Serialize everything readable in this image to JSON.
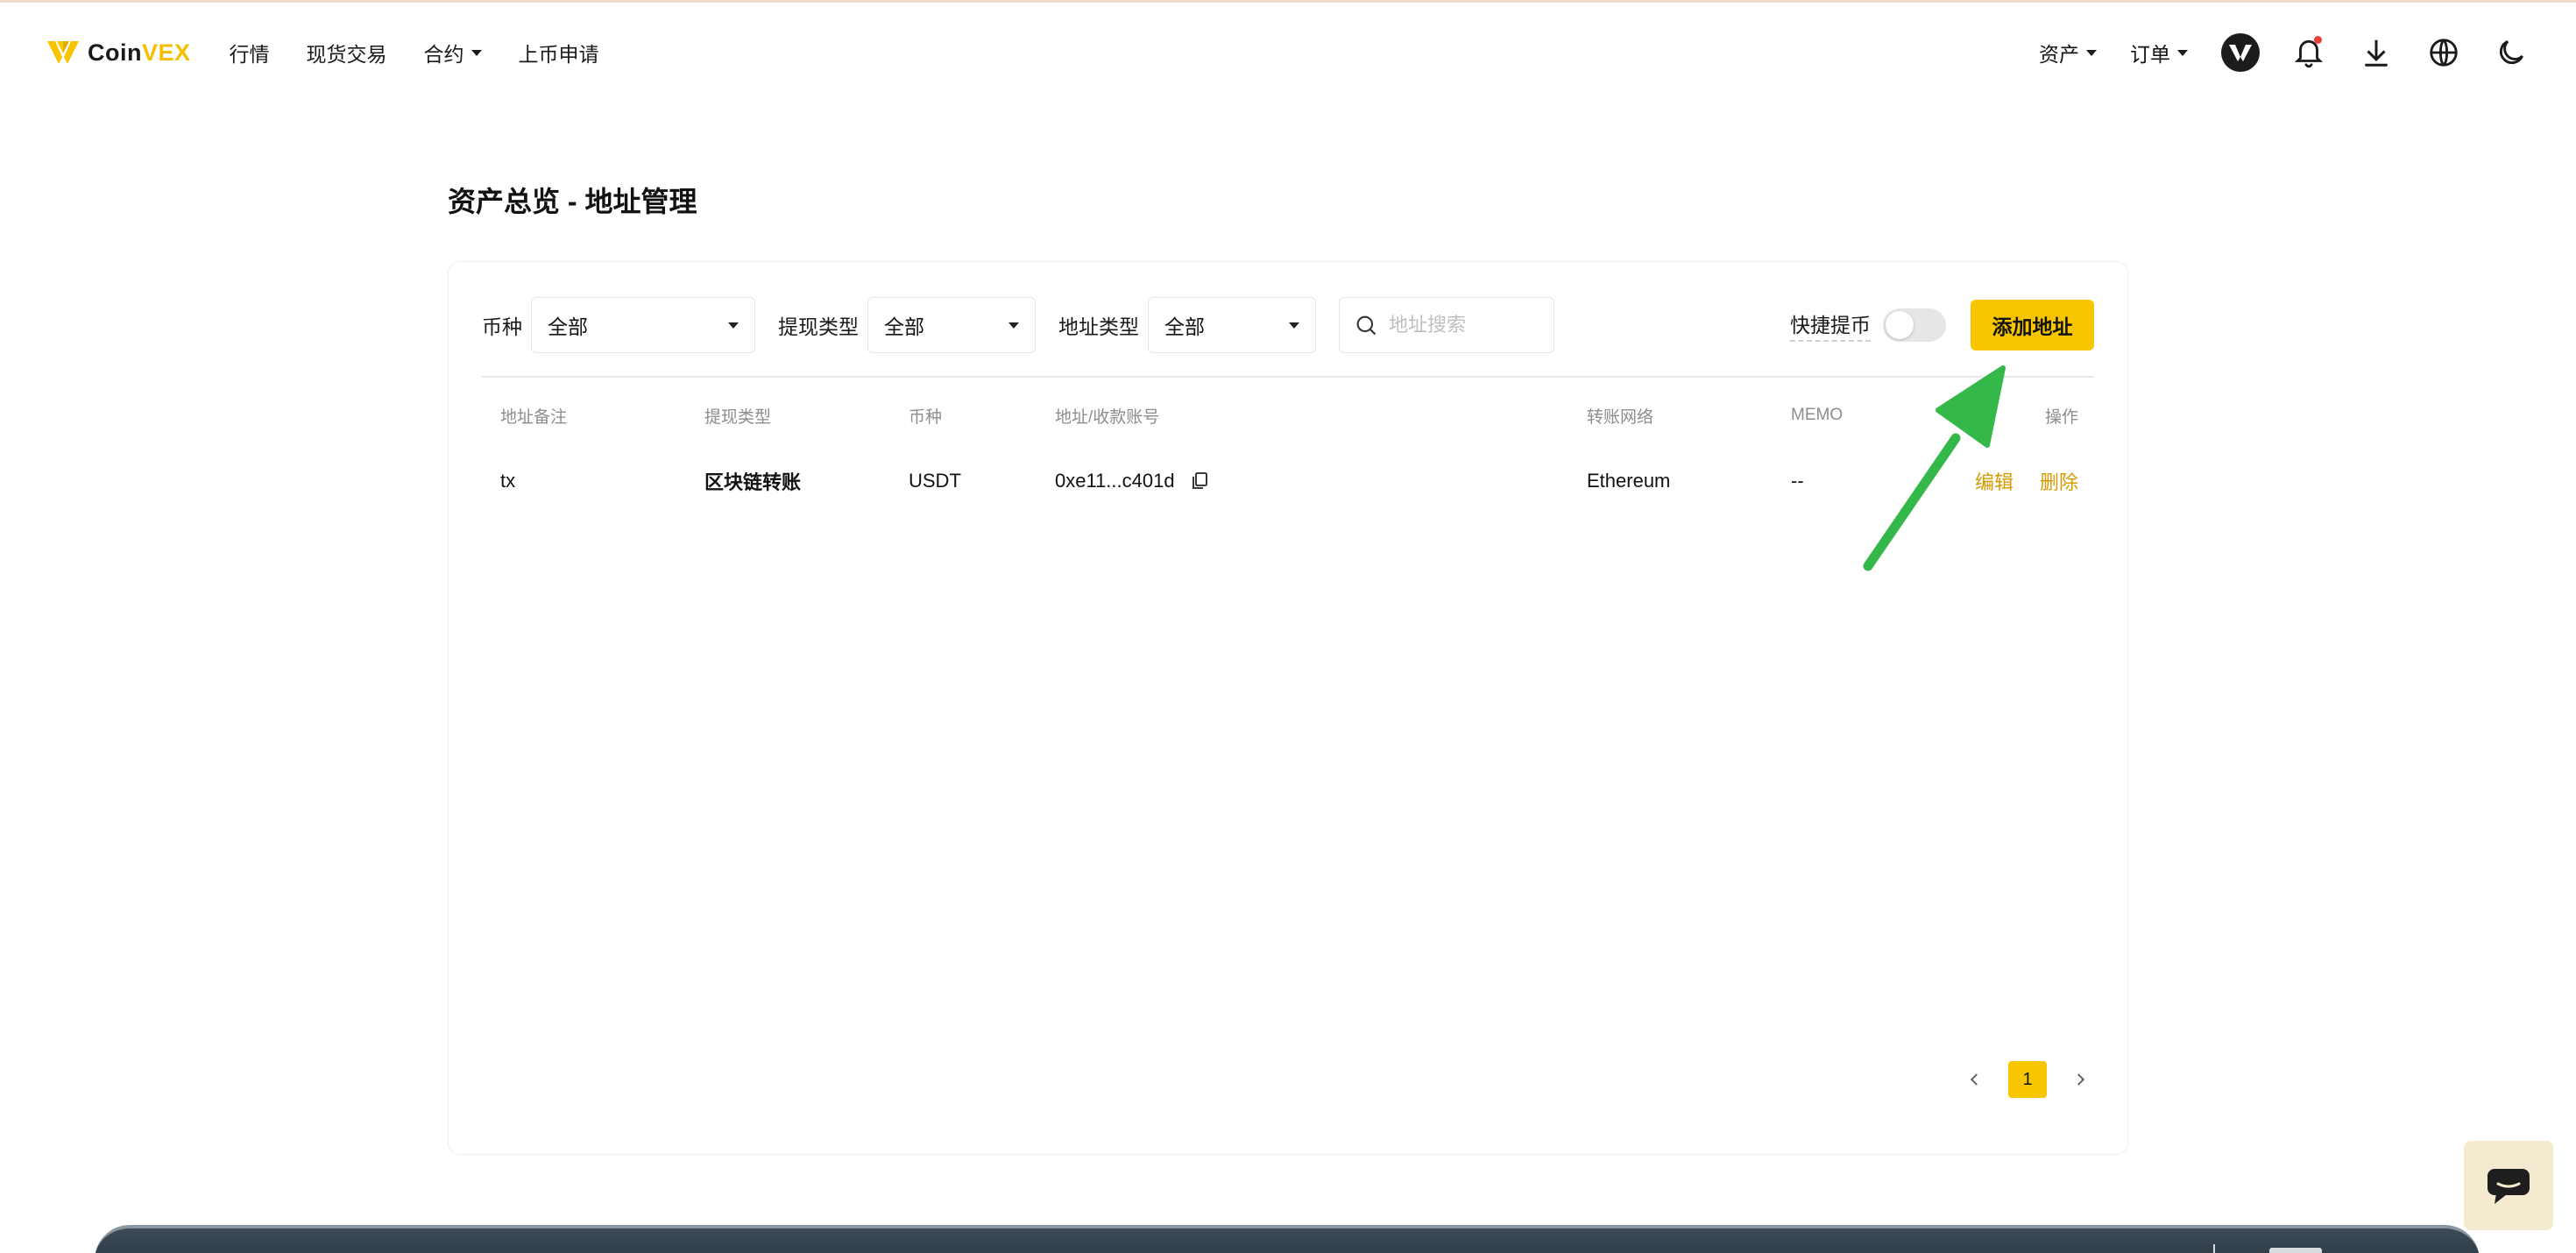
{
  "brand": {
    "name_part1": "Coin",
    "name_part2": "VEX",
    "accent_color": "#f7c600"
  },
  "nav": {
    "items": [
      {
        "label": "行情",
        "has_dropdown": false
      },
      {
        "label": "现货交易",
        "has_dropdown": false
      },
      {
        "label": "合约",
        "has_dropdown": true
      },
      {
        "label": "上币申请",
        "has_dropdown": false
      }
    ]
  },
  "header_right": {
    "assets_label": "资产",
    "orders_label": "订单",
    "icons": [
      "avatar",
      "bell-icon",
      "download-icon",
      "globe-icon",
      "moon-icon"
    ]
  },
  "page": {
    "title": "资产总览 - 地址管理"
  },
  "filters": {
    "coin_label": "币种",
    "coin_value": "全部",
    "withdraw_type_label": "提现类型",
    "withdraw_type_value": "全部",
    "address_type_label": "地址类型",
    "address_type_value": "全部",
    "search_placeholder": "地址搜索",
    "quick_withdraw_label": "快捷提币",
    "quick_withdraw_enabled": false,
    "add_address_label": "添加地址"
  },
  "table": {
    "headers": {
      "note": "地址备注",
      "type": "提现类型",
      "coin": "币种",
      "address": "地址/收款账号",
      "network": "转账网络",
      "memo": "MEMO",
      "action": "操作"
    },
    "rows": [
      {
        "note": "tx",
        "type": "区块链转账",
        "coin": "USDT",
        "address": "0xe11...c401d",
        "network": "Ethereum",
        "memo": "--",
        "edit_label": "编辑",
        "delete_label": "删除"
      }
    ]
  },
  "pagination": {
    "current_page": "1"
  }
}
